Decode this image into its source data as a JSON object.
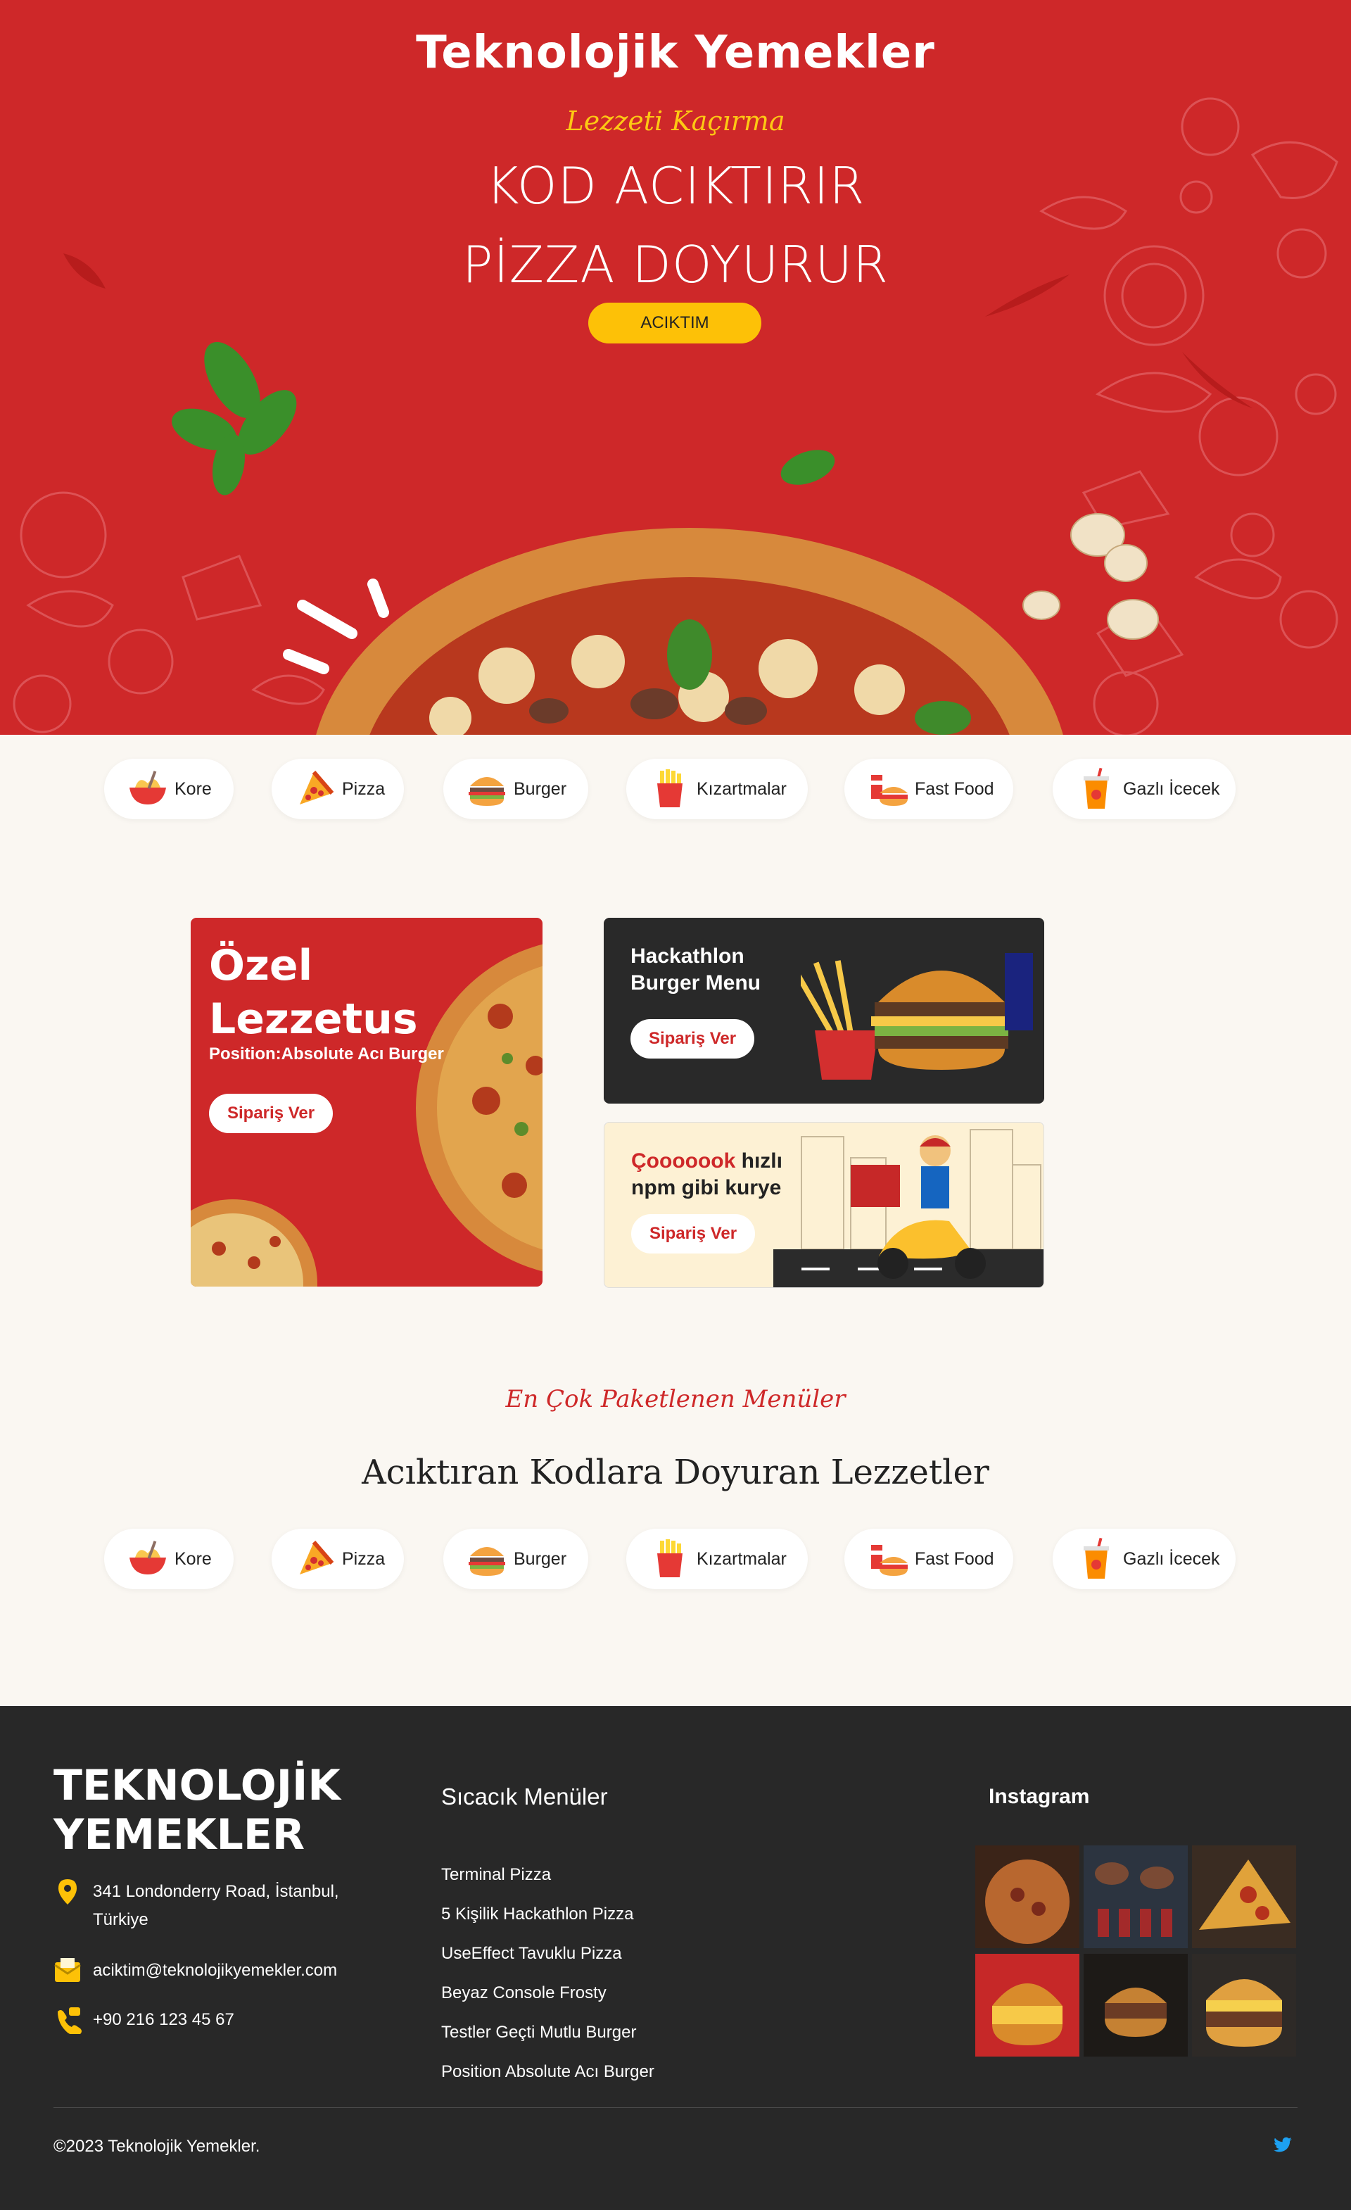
{
  "hero": {
    "brand": "Teknolojik Yemekler",
    "tagline": "Lezzeti Kaçırma",
    "headline_line1": "KOD ACIKTIRIR",
    "headline_line2": "PİZZA DOYURUR",
    "cta_label": "ACIKTIM",
    "colors": {
      "background": "#ce2829",
      "accent": "#fdc107"
    }
  },
  "categories": [
    {
      "label": "Kore",
      "icon": "ramen-bowl-icon"
    },
    {
      "label": "Pizza",
      "icon": "pizza-slice-icon"
    },
    {
      "label": "Burger",
      "icon": "burger-icon"
    },
    {
      "label": "Kızartmalar",
      "icon": "fries-icon"
    },
    {
      "label": "Fast Food",
      "icon": "fast-food-icon"
    },
    {
      "label": "Gazlı İcecek",
      "icon": "soda-cup-icon"
    }
  ],
  "promos": {
    "special": {
      "title": "Özel Lezzetus",
      "subtitle": "Position:Absolute Acı Burger",
      "button": "Sipariş Ver"
    },
    "hackathlon": {
      "title": "Hackathlon Burger Menu",
      "button": "Sipariş Ver"
    },
    "courier": {
      "title_highlight": "Çooooook",
      "title_rest": " hızlı npm gibi kurye",
      "button": "Sipariş Ver"
    }
  },
  "menu_section": {
    "script_title": "En Çok Paketlenen Menüler",
    "title": "Acıktıran Kodlara Doyuran Lezzetler"
  },
  "footer": {
    "brand": "TEKNOLOJİK YEMEKLER",
    "address": "341 Londonderry Road, İstanbul, Türkiye",
    "email": "aciktim@teknolojikyemekler.com",
    "phone": "+90 216 123 45 67",
    "menu_title": "Sıcacık Menüler",
    "menu_links": [
      "Terminal Pizza",
      "5 Kişilik Hackathlon Pizza",
      "UseEffect Tavuklu Pizza",
      "Beyaz Console Frosty",
      "Testler Geçti Mutlu Burger",
      "Position Absolute Acı Burger"
    ],
    "instagram_title": "Instagram",
    "copyright": "©2023 Teknolojik Yemekler.",
    "social": "twitter-icon"
  }
}
